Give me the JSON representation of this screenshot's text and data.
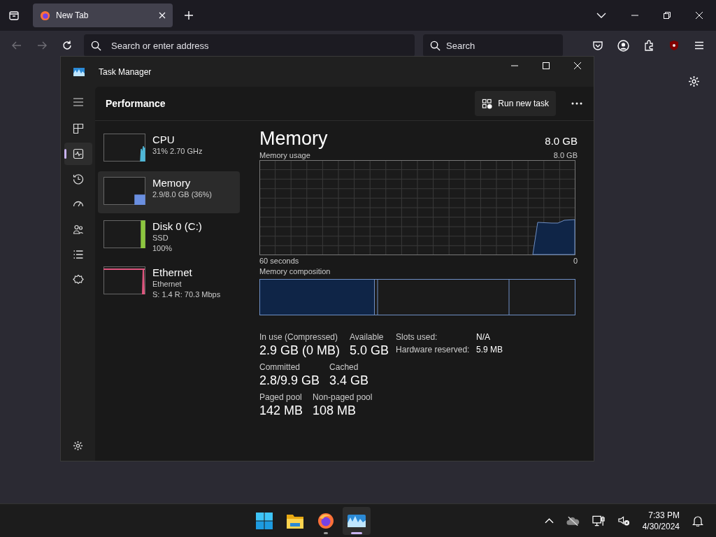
{
  "browser": {
    "tabs": [
      {
        "label": "New Tab",
        "selected": true
      }
    ],
    "address_bar": {
      "placeholder": "Search or enter address"
    },
    "search_bar": {
      "placeholder": "Search"
    }
  },
  "task_manager": {
    "title": "Task Manager",
    "nav": [
      {
        "selected": false
      },
      {
        "selected": true
      },
      {
        "selected": false
      },
      {
        "selected": false
      },
      {
        "selected": false
      },
      {
        "selected": false
      },
      {
        "selected": false
      },
      {
        "selected": false
      }
    ],
    "page_title": "Performance",
    "run_new_task": "Run new task",
    "resources": [
      {
        "name": "CPU",
        "details": [
          "31%  2.70 GHz"
        ],
        "color": "#4fb6d6",
        "selected": false
      },
      {
        "name": "Memory",
        "details": [
          "2.9/8.0 GB (36%)"
        ],
        "color": "#6a8fe0",
        "selected": true
      },
      {
        "name": "Disk 0 (C:)",
        "details": [
          "SSD",
          "100%"
        ],
        "color": "#8cc63f",
        "selected": false
      },
      {
        "name": "Ethernet",
        "details": [
          "Ethernet",
          "S: 1.4  R: 70.3 Mbps"
        ],
        "color": "#e0567f",
        "selected": false
      }
    ],
    "detail": {
      "title": "Memory",
      "total": "8.0 GB",
      "usage_label": "Memory usage",
      "usage_max": "8.0 GB",
      "time_span": "60 seconds",
      "usage_min": "0",
      "composition_label": "Memory composition",
      "stats": [
        [
          {
            "label": "In use (Compressed)",
            "value": "2.9 GB (0 MB)"
          },
          {
            "label": "Available",
            "value": "5.0 GB"
          }
        ],
        [
          {
            "label": "Committed",
            "value": "2.8/9.9 GB"
          },
          {
            "label": "Cached",
            "value": "3.4 GB"
          }
        ],
        [
          {
            "label": "Paged pool",
            "value": "142 MB"
          },
          {
            "label": "Non-paged pool",
            "value": "108 MB"
          }
        ]
      ],
      "info": [
        {
          "label": "Slots used:",
          "value": "N/A"
        },
        {
          "label": "Hardware reserved:",
          "value": "5.9 MB"
        }
      ]
    }
  },
  "taskbar": {
    "apps": [
      {
        "selected": false,
        "running": false
      },
      {
        "selected": false,
        "running": false
      },
      {
        "selected": false,
        "running": true
      },
      {
        "selected": true,
        "running": true
      }
    ],
    "time": "7:33 PM",
    "date": "4/30/2024"
  }
}
